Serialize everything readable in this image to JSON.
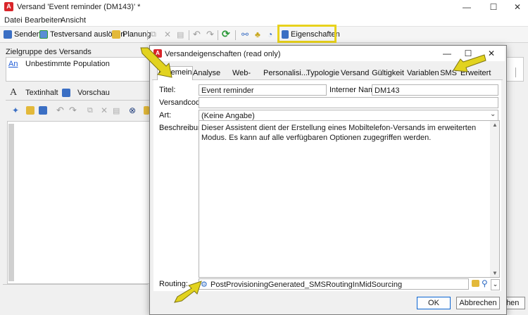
{
  "window": {
    "title": "Versand 'Event reminder (DM143)' *"
  },
  "menu": [
    "Datei",
    "Bearbeiten",
    "Ansicht"
  ],
  "toolbar": {
    "send": "Senden",
    "test_send": "Testversand auslösen",
    "schedule": "Planung",
    "properties": "Eigenschaften"
  },
  "target": {
    "label": "Zielgruppe des Versands",
    "link": "An",
    "value": "Unbestimmte Population"
  },
  "content_tabs": {
    "text": "Textinhalt",
    "preview": "Vorschau"
  },
  "dialog": {
    "title": "Versandeigenschaften (read only)",
    "tabs": [
      "Allgemein",
      "Analyse",
      "Web-Anal...",
      "Personalisi...",
      "Typologie",
      "Versand",
      "Gültigkeit",
      "Variablen",
      "SMS",
      "Erweitert"
    ],
    "active_tab": "Allgemein",
    "fields": {
      "title_label": "Titel:",
      "title_value": "Event reminder",
      "internal_name_label": "Interner Name:",
      "internal_name_value": "DM143",
      "code_label": "Versandcode:",
      "code_value": "",
      "type_label": "Art:",
      "type_value": "(Keine Angabe)",
      "description_label": "Beschreibung:",
      "description_value": "Dieser Assistent dient der Erstellung eines Mobiltelefon-Versands im erweiterten Modus. Es kann auf alle verfügbaren Optionen zugegriffen werden.",
      "routing_label": "Routing:",
      "routing_value": "PostProvisioningGenerated_SMSRoutingInMidSourcing"
    },
    "buttons": {
      "ok": "OK",
      "cancel": "Abbrechen"
    }
  },
  "background_button": "chen",
  "colors": {
    "highlight": "#e8d21c",
    "arrow": "#e2d31f",
    "brand": "#d9252a",
    "link": "#1c5ad6"
  }
}
